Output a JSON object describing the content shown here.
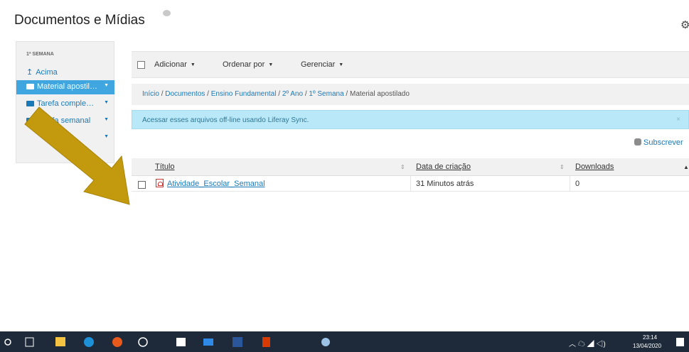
{
  "page": {
    "title": "Documentos e Mídias"
  },
  "sidebar": {
    "header": "1ª SEMANA",
    "up_label": "Acima",
    "items": [
      {
        "label": "Material apostil…",
        "active": true
      },
      {
        "label": "Tarefa comple…",
        "active": false
      },
      {
        "label": "Tarefa semanal",
        "active": false
      },
      {
        "label": "",
        "active": false
      }
    ]
  },
  "toolbar": {
    "add_label": "Adicionar",
    "sort_label": "Ordenar por",
    "manage_label": "Gerenciar"
  },
  "breadcrumb": {
    "items": [
      "Início",
      "Documentos",
      "Ensino Fundamental",
      "2º Ano",
      "1º Semana"
    ],
    "current": "Material apostilado",
    "separator": "/"
  },
  "alert": {
    "text": "Acessar esses arquivos off-line usando Liferay Sync.",
    "close": "×"
  },
  "subscribe_label": "Subscrever",
  "table": {
    "columns": [
      "Título",
      "Data de criação",
      "Downloads"
    ],
    "rows": [
      {
        "title": "Atividade_Escolar_Semanal",
        "created": "31 Minutos atrás",
        "downloads": "0"
      }
    ]
  },
  "taskbar": {
    "time": "23:14",
    "date": "13/04/2020"
  },
  "colors": {
    "accent": "#3fa6df",
    "link": "#1a7ab8",
    "alert_bg": "#b9e8f8",
    "arrow": "#c39a0e",
    "taskbar": "#1e2a3a"
  },
  "icons": [
    "gear-icon",
    "arrow-up-icon",
    "folder-open-icon",
    "folder-icon",
    "pdf-icon",
    "rss-icon",
    "sort-icon",
    "windows-start-icon"
  ]
}
